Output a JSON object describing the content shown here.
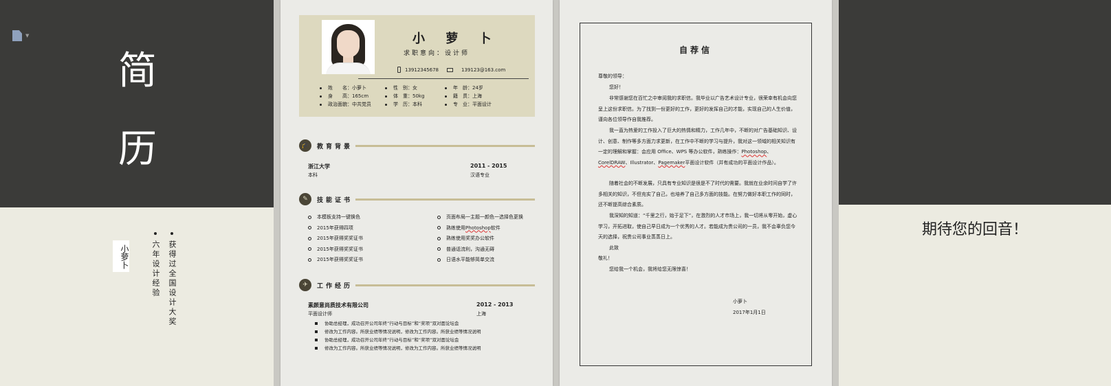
{
  "cover": {
    "char1": "简",
    "char2": "历",
    "name": "小萝卜",
    "bullet1": "六年设计经验",
    "bullet2": "获得过全国设计大奖"
  },
  "resume": {
    "name": "小 萝 卜",
    "intent": "求职意向：设计师",
    "phone": "13912345678",
    "email": "139123@163.com",
    "info": [
      [
        "姓　　名：小萝卜",
        "性　别：女",
        "年　龄：24岁"
      ],
      [
        "身　　高：165cm",
        "体　重：50kg",
        "籍　贯：上海"
      ],
      [
        "政治面貌：中共党员",
        "学　历：本科",
        "专　业：平面设计"
      ]
    ],
    "edu": {
      "heading": "教育背景",
      "school": "浙江大学",
      "years": "2011 - 2015",
      "degree": "本科",
      "major": "汉语专业"
    },
    "skills": {
      "heading": "技能证书",
      "left": [
        "本模板支持一键换色",
        "2015年获得四项",
        "2015年获得奖奖证书",
        "2015年获得奖奖证书",
        "2015年获得奖奖证书"
      ],
      "right_pre": "页面布局一主题一颜色一选择色更换",
      "right_ps_a": "熟练使用",
      "right_ps_b": "Photoshop",
      "right_ps_c": "软件",
      "right": [
        "熟练使用奖奖办公软件",
        "普通话流利，沟通无碍",
        "日语水平能够简单交流"
      ]
    },
    "work": {
      "heading": "工作经历",
      "company": "素颜意尚质技术有限公司",
      "years": "2012 - 2013",
      "role": "平面设计师",
      "city": "上海",
      "items": [
        "协助总经理，成功召开公司年终“行动与目标”和“奖项”双对面论坛会",
        "修改为工作内容。所获业绩等情况说明，修改为工作内容。所获业绩等情况说明",
        "协助总经理，成功召开公司年终“行动与目标”和“奖项”双对面论坛会",
        "修改为工作内容。所获业绩等情况说明，修改为工作内容。所获业绩等情况说明"
      ]
    }
  },
  "letter": {
    "title": "自荐信",
    "salutation": "尊敬的领导：",
    "hello": "您好！",
    "para1": "非常感谢您在百忙之中审阅我的求职信。我毕业以广告艺术设计专业，很荣幸有机会向您呈上这份求职信。为了找到一份更好的工作，更好的发挥自己的才能，实现自己的人生价值，谨向各位领导作自我推荐。",
    "para2_a": "我一直为热爱的工作投入了巨大的热情和精力，工作几年中，不断的对广告基础知识、设计、创意、制作等多方面力求更新，在工作中不断的学习与提升，我对这一领域的相关知识有一定的理解和掌握：会应用 Office、WPS 等办公软件，熟练操作：",
    "para2_ps": "Photoshop",
    "para2_sep1": "、",
    "para2_cd": "CorelDRAW",
    "para2_sep2": "、Illustrator、",
    "para2_pm": "Pagemaker",
    "para2_b": "平面设计软件（并有成功的平面设计作品）。",
    "para3": "随着社会的不断发展，只具有专业知识是很是不了时代的需要。我就在业余时间自学了许多相关的知识，不但充实了自己，也培养了自己多方面的技能。在努力做好本职工作的同时，还不断提高综合素质。",
    "para4": "我深知的知道：“千里之行，始于足下”，在激烈的人才市场上，我一切将从零开始，虚心学习，开拓进取，使自己早日成为一个优秀的人才。若能成为贵公司的一员，我不会辜负您今天的选择，祝贵公司事业蒸蒸日上。",
    "cizhi": "此致",
    "jingli": "敬礼！",
    "closing": "您给我一个机会，我将给您无限惊喜！",
    "sign_name": "小萝卜",
    "sign_date": "2017年1月1日"
  },
  "final": {
    "text": "期待您的回音！"
  },
  "colors": {
    "dark": "#3b3b39",
    "cream": "#ecebe1",
    "header_bg": "#ddd9bf",
    "accent_line": "#c7bd96"
  }
}
